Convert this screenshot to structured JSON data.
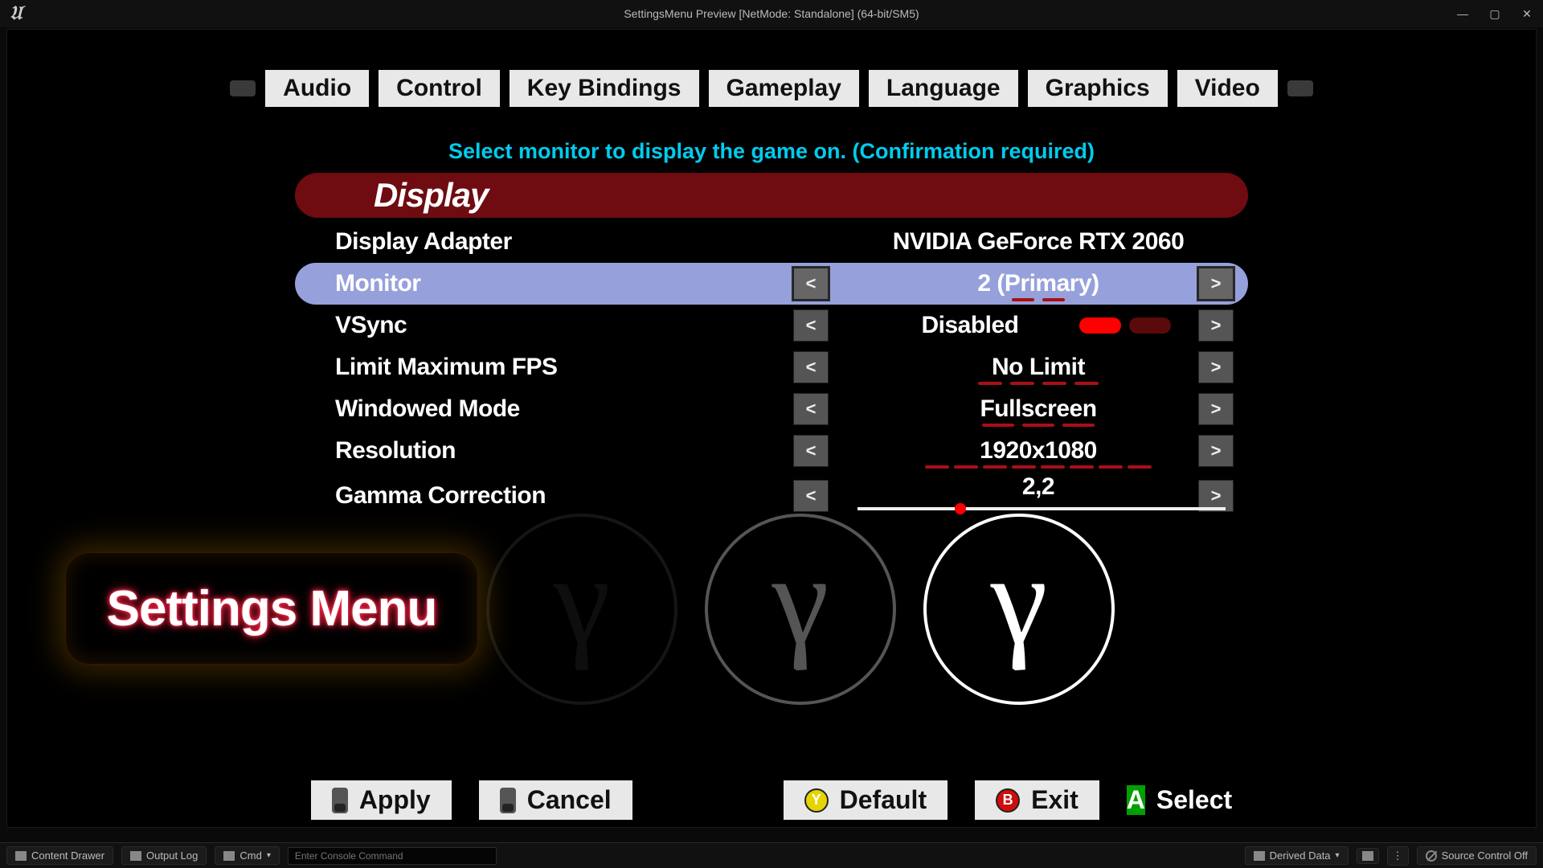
{
  "titlebar": "SettingsMenu Preview [NetMode: Standalone]  (64-bit/SM5)",
  "tabs": [
    "Audio",
    "Control",
    "Key Bindings",
    "Gameplay",
    "Language",
    "Graphics",
    "Video"
  ],
  "description": "Select monitor to display the game on. (Confirmation required)",
  "section": "Display",
  "rows": {
    "adapter": {
      "label": "Display Adapter",
      "value": "NVIDIA GeForce RTX 2060"
    },
    "monitor": {
      "label": "Monitor",
      "value": "2 (Primary)"
    },
    "vsync": {
      "label": "VSync",
      "value": "Disabled"
    },
    "fps": {
      "label": "Limit Maximum FPS",
      "value": "No Limit"
    },
    "window": {
      "label": "Windowed Mode",
      "value": "Fullscreen"
    },
    "res": {
      "label": "Resolution",
      "value": "1920x1080"
    },
    "gamma": {
      "label": "Gamma Correction",
      "value": "2,2",
      "slider_frac": 0.28
    }
  },
  "badge": "Settings Menu",
  "footer": {
    "apply": "Apply",
    "cancel": "Cancel",
    "default": "Default",
    "exit": "Exit",
    "select": "Select"
  },
  "status": {
    "drawer": "Content Drawer",
    "log": "Output Log",
    "cmd": "Cmd",
    "console_ph": "Enter Console Command",
    "derived": "Derived Data",
    "source": "Source Control Off"
  },
  "glyphs": {
    "arrow_left": "<",
    "arrow_right": ">",
    "gamma": "γ"
  },
  "colors": {
    "accent": "#00ccee",
    "section": "#6e0c12",
    "selected": "#96a0db",
    "danger": "#aa0f16"
  }
}
